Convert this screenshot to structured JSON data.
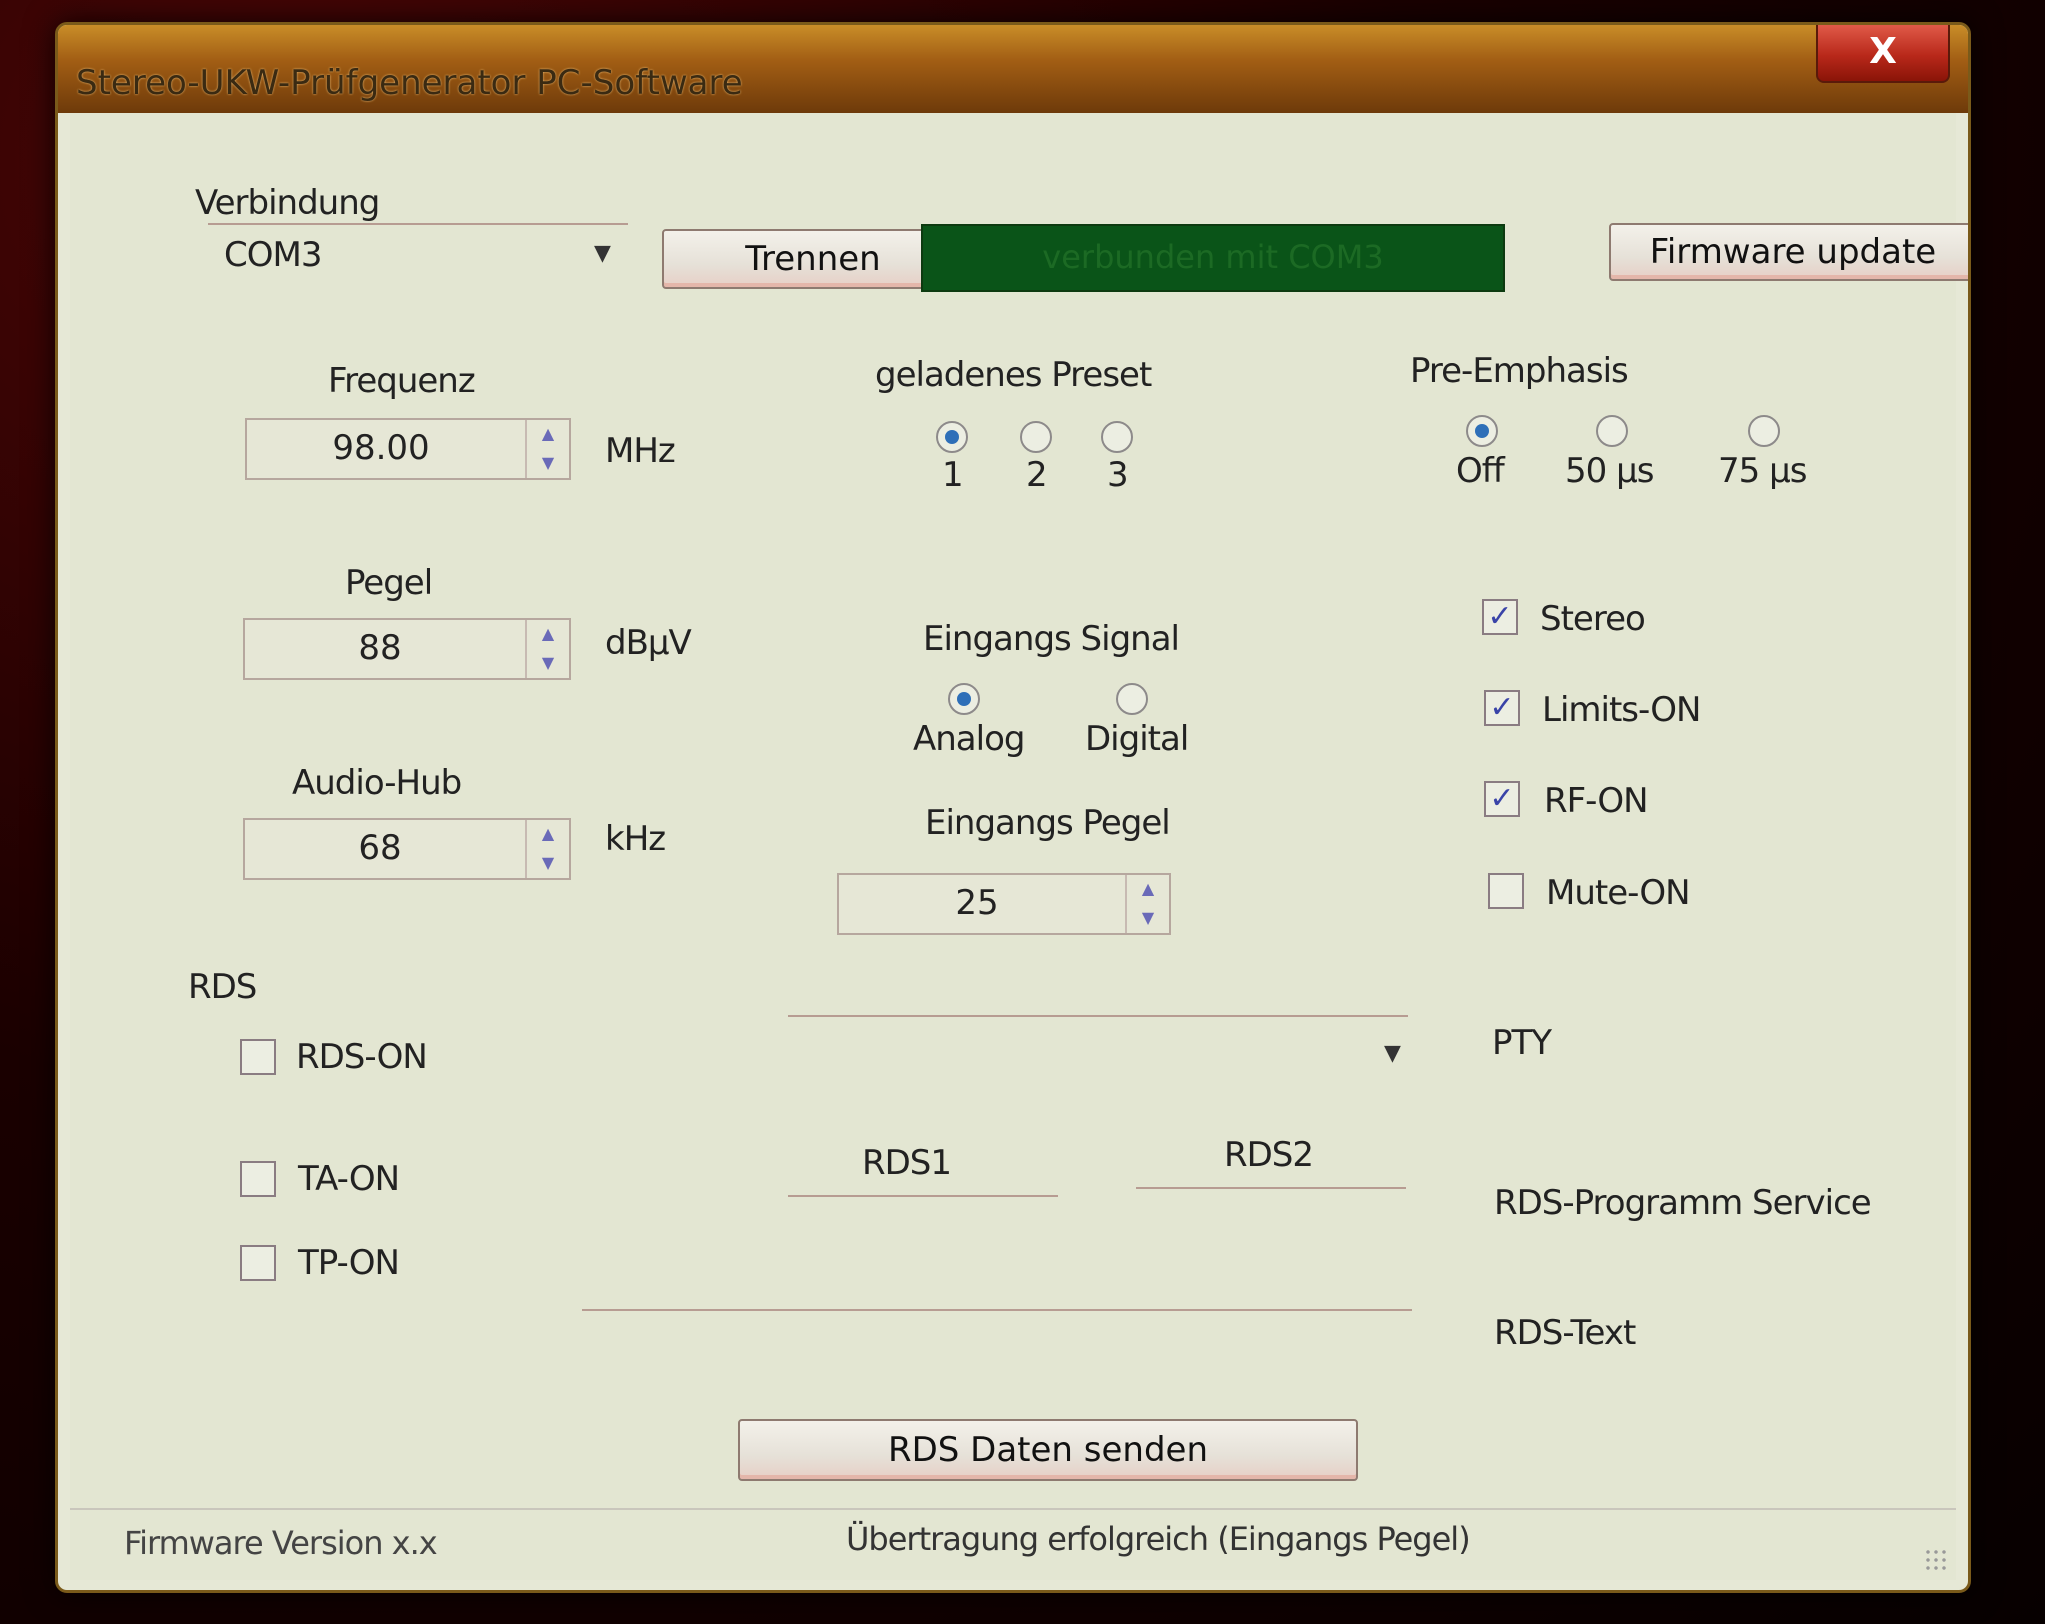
{
  "window": {
    "title": "Stereo-UKW-Prüfgenerator PC-Software",
    "close_label": "X"
  },
  "connection": {
    "section_label": "Verbindung",
    "port_value": "COM3",
    "disconnect_label": "Trennen",
    "status_text": "verbunden mit COM3",
    "status_color": "#0a5418",
    "firmware_update_label": "Firmware update"
  },
  "frequency": {
    "label": "Frequenz",
    "value": "98.00",
    "unit": "MHz"
  },
  "level": {
    "label": "Pegel",
    "value": "88",
    "unit": "dBµV"
  },
  "audio_hub": {
    "label": "Audio-Hub",
    "value": "68",
    "unit": "kHz"
  },
  "preset": {
    "label": "geladenes Preset",
    "options": [
      {
        "label": "1",
        "selected": true
      },
      {
        "label": "2",
        "selected": false
      },
      {
        "label": "3",
        "selected": false
      }
    ]
  },
  "pre_emphasis": {
    "label": "Pre-Emphasis",
    "options": [
      {
        "label": "Off",
        "selected": true
      },
      {
        "label": "50 µs",
        "selected": false
      },
      {
        "label": "75 µs",
        "selected": false
      }
    ]
  },
  "input_signal": {
    "label": "Eingangs Signal",
    "options": [
      {
        "label": "Analog",
        "selected": true
      },
      {
        "label": "Digital",
        "selected": false
      }
    ]
  },
  "input_level": {
    "label": "Eingangs Pegel",
    "value": "25"
  },
  "flags": {
    "stereo": {
      "label": "Stereo",
      "checked": true
    },
    "limits": {
      "label": "Limits-ON",
      "checked": true
    },
    "rf": {
      "label": "RF-ON",
      "checked": true
    },
    "mute": {
      "label": "Mute-ON",
      "checked": false
    }
  },
  "rds": {
    "section_label": "RDS",
    "rds_on": {
      "label": "RDS-ON",
      "checked": false
    },
    "ta_on": {
      "label": "TA-ON",
      "checked": false
    },
    "tp_on": {
      "label": "TP-ON",
      "checked": false
    },
    "pty_label": "PTY",
    "rds1_label": "RDS1",
    "rds2_label": "RDS2",
    "program_service_label": "RDS-Programm Service",
    "text_label": "RDS-Text",
    "send_button_label": "RDS Daten senden"
  },
  "statusbar": {
    "firmware_version": "Firmware Version x.x",
    "message": "Übertragung erfolgreich (Eingangs Pegel)"
  }
}
